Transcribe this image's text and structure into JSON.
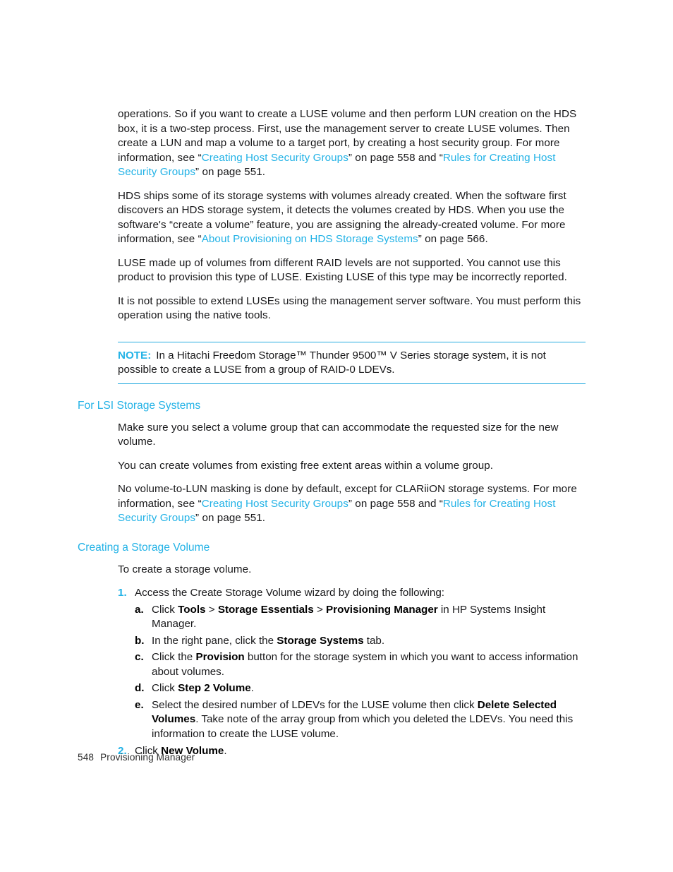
{
  "colors": {
    "link": "#22b2e6",
    "heading": "#22b2e6",
    "rule": "#27ace0",
    "text": "#18181a"
  },
  "body": {
    "para1": {
      "t1": "operations. So if you want to create a LUSE volume and then perform LUN creation on the HDS box, it is a two-step process. First, use the management server to create LUSE volumes. Then create a LUN and map a volume to a target port, by creating a host security group. For more information, see “",
      "link1": "Creating Host Security Groups",
      "t2": "” on page 558 and “",
      "link2": "Rules for Creating Host Security Groups",
      "t3": "” on page 551."
    },
    "para2": {
      "t1": "HDS ships some of its storage systems with volumes already created. When the software first discovers an HDS storage system, it detects the volumes created by HDS. When you use the software's “create a volume” feature, you are assigning the already-created volume. For more information, see “",
      "link1": "About Provisioning on HDS Storage Systems",
      "t2": "” on page 566."
    },
    "para3": "LUSE made up of volumes from different RAID levels are not supported. You cannot use this product to provision this type of LUSE. Existing LUSE of this type may be incorrectly reported.",
    "para4": "It is not possible to extend LUSEs using the management server software. You must perform this operation using the native tools."
  },
  "note": {
    "label": "NOTE:",
    "text": "In a Hitachi Freedom Storage™ Thunder 9500™ V Series storage system, it is not possible to create a LUSE from a group of RAID-0 LDEVs."
  },
  "sections": {
    "lsi": {
      "heading": "For LSI Storage Systems",
      "para1": "Make sure you select a volume group that can accommodate the requested size for the new volume.",
      "para2": "You can create volumes from existing free extent areas within a volume group.",
      "para3": {
        "t1": "No volume-to-LUN masking is done by default, except for CLARiiON storage systems. For more information, see “",
        "link1": "Creating Host Security Groups",
        "t2": "” on page 558 and “",
        "link2": "Rules for Creating Host Security Groups",
        "t3": "” on page 551."
      }
    },
    "creating_volume": {
      "heading": "Creating a Storage Volume",
      "intro": "To create a storage volume.",
      "steps": [
        {
          "marker": "1.",
          "text": "Access the Create Storage Volume wizard by doing the following:",
          "substeps": [
            {
              "marker": "a.",
              "t1": "Click ",
              "b1": "Tools",
              "t2": " > ",
              "b2": "Storage Essentials",
              "t3": " > ",
              "b3": "Provisioning Manager",
              "t4": " in HP Systems Insight Manager."
            },
            {
              "marker": "b.",
              "t1": "In the right pane, click the ",
              "b1": "Storage Systems",
              "t2": " tab."
            },
            {
              "marker": "c.",
              "t1": "Click the ",
              "b1": "Provision",
              "t2": " button for the storage system in which you want to access information about volumes."
            },
            {
              "marker": "d.",
              "t1": "Click ",
              "b1": "Step 2 Volume",
              "t2": "."
            },
            {
              "marker": "e.",
              "t1": "Select the desired number of LDEVs for the LUSE volume then click ",
              "b1": "Delete Selected Volumes",
              "t2": ". Take note of the array group from which you deleted the LDEVs. You need this information to create the LUSE volume."
            }
          ]
        },
        {
          "marker": "2.",
          "t1": "Click ",
          "b1": "New Volume",
          "t2": "."
        }
      ]
    }
  },
  "footer": {
    "page_number": "548",
    "chapter": "Provisioning Manager"
  }
}
